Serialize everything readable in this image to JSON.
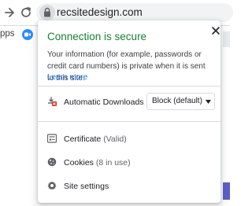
{
  "browser": {
    "url": "recsitedesign.com",
    "bookmarks": {
      "apps_label": "pps"
    }
  },
  "popup": {
    "title": "Connection is secure",
    "description": "Your information (for example, passwords or credit card numbers) is private when it is sent to this site.",
    "learn_more": "Learn more",
    "automatic_downloads": {
      "label": "Automatic Downloads",
      "selected": "Block (default)"
    },
    "certificate": {
      "label": "Certificate",
      "status": "(Valid)"
    },
    "cookies": {
      "label": "Cookies",
      "status": "(8 in use)"
    },
    "site_settings": {
      "label": "Site settings"
    }
  },
  "colors": {
    "secure_green": "#188038",
    "link_blue": "#1a73e8",
    "side_strip_purple": "#5b5fc7"
  }
}
